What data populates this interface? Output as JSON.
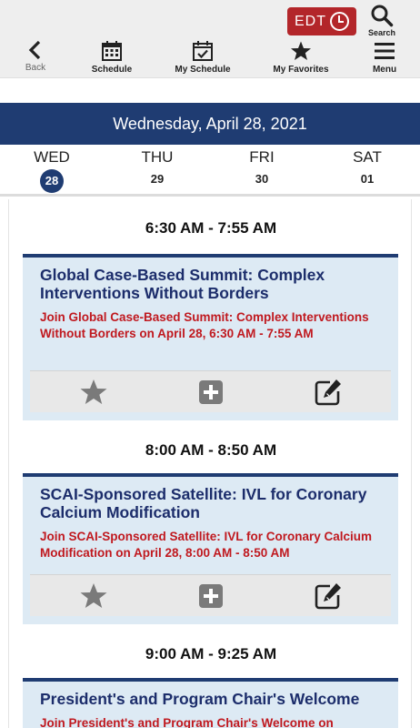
{
  "header": {
    "timezone_label": "EDT",
    "search_label": "Search",
    "nav": [
      {
        "label": "Back"
      },
      {
        "label": "Schedule"
      },
      {
        "label": "My Schedule"
      },
      {
        "label": "My Favorites"
      },
      {
        "label": "Menu"
      }
    ]
  },
  "date_title": "Wednesday, April 28, 2021",
  "days": [
    {
      "name": "WED",
      "num": "28"
    },
    {
      "name": "THU",
      "num": "29"
    },
    {
      "name": "FRI",
      "num": "30"
    },
    {
      "name": "SAT",
      "num": "01"
    }
  ],
  "sessions": [
    {
      "time": "6:30 AM - 7:55 AM",
      "title": "Global Case-Based Summit: Complex Interventions Without Borders",
      "description": "Join Global Case-Based Summit: Complex Interventions Without Borders on April 28, 6:30 AM - 7:55 AM"
    },
    {
      "time": "8:00 AM - 8:50 AM",
      "title": "SCAI-Sponsored Satellite: IVL for Coronary Calcium Modification",
      "description": "Join SCAI-Sponsored Satellite: IVL for Coronary Calcium Modification on April 28, 8:00 AM - 8:50 AM"
    },
    {
      "time": "9:00 AM - 9:25 AM",
      "title": "President's and Program Chair's Welcome",
      "description": "Join President's and Program Chair's Welcome on"
    }
  ],
  "colors": {
    "navy": "#1f3c72",
    "title_blue": "#1c2d6b",
    "accent_red": "#c0191f",
    "edt_red": "#b3262a",
    "card_bg": "#ddeaf4"
  }
}
